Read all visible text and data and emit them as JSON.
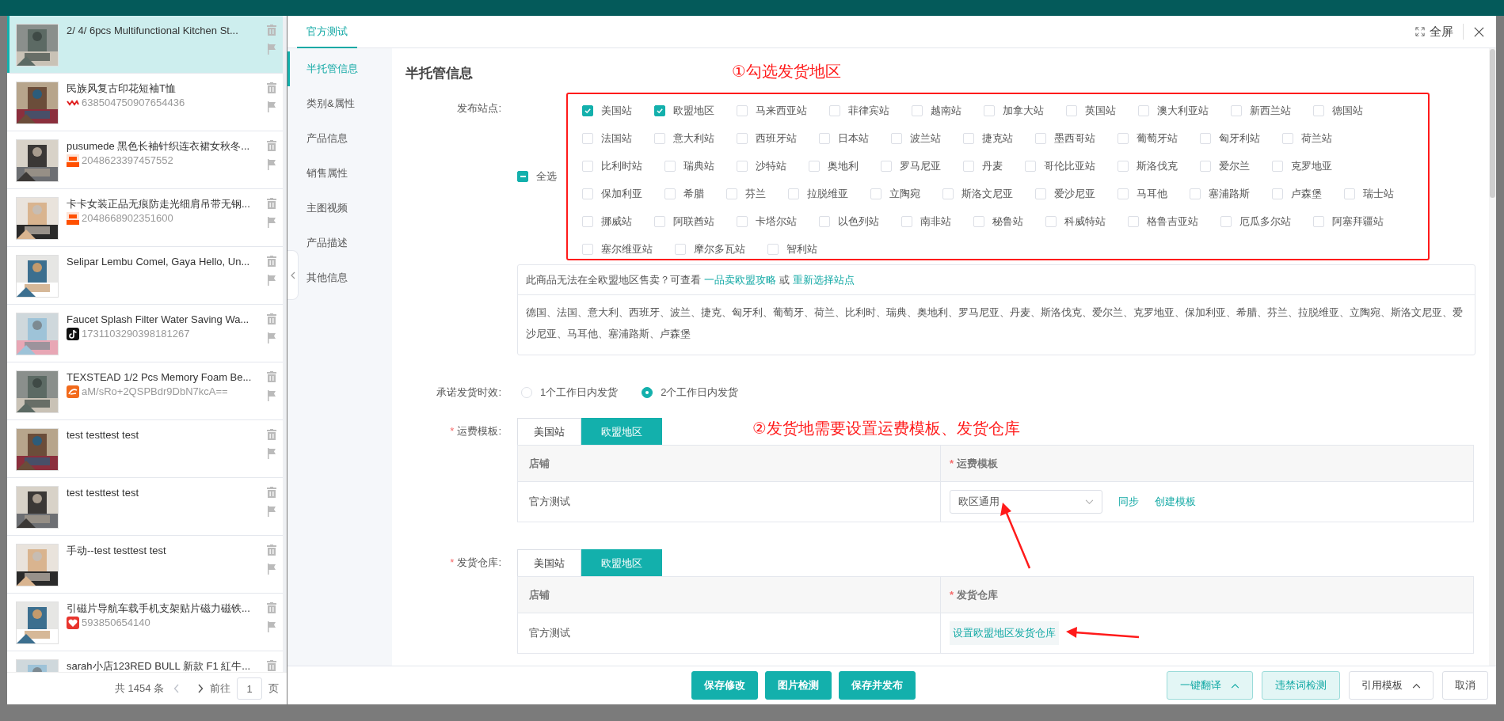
{
  "product_list": {
    "items": [
      {
        "title": "2/ 4/ 6pcs Multifunctional Kitchen St...",
        "selected": true
      },
      {
        "title": "民族风复古印花短袖T恤",
        "source": {
          "id": "638504750907654436",
          "kind": "yms"
        },
        "selected": false
      },
      {
        "title": "pusumede 黑色长袖针织连衣裙女秋冬...",
        "source": {
          "id": "2048623397457552",
          "kind": "taobao"
        },
        "selected": false
      },
      {
        "title": "卡卡女装正品无痕防走光细肩吊带无钢...",
        "source": {
          "id": "2048668902351600",
          "kind": "taobao"
        },
        "selected": false
      },
      {
        "title": "Selipar Lembu Comel, Gaya Hello, Un...",
        "selected": false
      },
      {
        "title": "Faucet Splash Filter Water Saving Wa...",
        "source": {
          "id": "1731103290398181267",
          "kind": "tiktok"
        },
        "selected": false
      },
      {
        "title": "TEXSTEAD 1/2 Pcs Memory Foam Be...",
        "source": {
          "id": "aM/sRo+2QSPBdr9DbN7kcA==",
          "kind": "alibaba"
        },
        "selected": false
      },
      {
        "title": "test testtest test",
        "selected": false
      },
      {
        "title": "test testtest test",
        "selected": false
      },
      {
        "title": "手动--test testtest test",
        "selected": false
      },
      {
        "title": "引磁片导航车载手机支架贴片磁力磁铁...",
        "source": {
          "id": "593850654140",
          "kind": "heart"
        },
        "selected": false
      },
      {
        "title": "sarah小店123RED BULL 新款 F1 紅牛...",
        "selected": false
      }
    ],
    "pagination": {
      "total": "共 1454 条",
      "goto": "前往",
      "page": "1",
      "suffix": "页"
    }
  },
  "dialog": {
    "tabs": [
      {
        "label": "官方测试",
        "selected": true
      }
    ],
    "fullscreen": "全屏",
    "nav": [
      {
        "label": "半托管信息",
        "selected": true
      },
      {
        "label": "类别&属性",
        "selected": false
      },
      {
        "label": "产品信息",
        "selected": false
      },
      {
        "label": "销售属性",
        "selected": false
      },
      {
        "label": "主图视频",
        "selected": false
      },
      {
        "label": "产品描述",
        "selected": false
      },
      {
        "label": "其他信息",
        "selected": false
      }
    ],
    "section_title": "半托管信息",
    "sites": {
      "label": "发布站点:",
      "select_all": {
        "label": "全选",
        "indeterminate": true
      },
      "options": [
        {
          "label": "美国站",
          "checked": true
        },
        {
          "label": "欧盟地区",
          "checked": true
        },
        {
          "label": "马来西亚站",
          "checked": false
        },
        {
          "label": "菲律宾站",
          "checked": false
        },
        {
          "label": "越南站",
          "checked": false
        },
        {
          "label": "加拿大站",
          "checked": false
        },
        {
          "label": "英国站",
          "checked": false
        },
        {
          "label": "澳大利亚站",
          "checked": false
        },
        {
          "label": "新西兰站",
          "checked": false
        },
        {
          "label": "德国站",
          "checked": false
        },
        {
          "label": "法国站",
          "checked": false
        },
        {
          "label": "意大利站",
          "checked": false
        },
        {
          "label": "西班牙站",
          "checked": false
        },
        {
          "label": "日本站",
          "checked": false
        },
        {
          "label": "波兰站",
          "checked": false
        },
        {
          "label": "捷克站",
          "checked": false
        },
        {
          "label": "墨西哥站",
          "checked": false
        },
        {
          "label": "葡萄牙站",
          "checked": false
        },
        {
          "label": "匈牙利站",
          "checked": false
        },
        {
          "label": "荷兰站",
          "checked": false
        },
        {
          "label": "比利时站",
          "checked": false
        },
        {
          "label": "瑞典站",
          "checked": false
        },
        {
          "label": "沙特站",
          "checked": false
        },
        {
          "label": "奥地利",
          "checked": false
        },
        {
          "label": "罗马尼亚",
          "checked": false
        },
        {
          "label": "丹麦",
          "checked": false
        },
        {
          "label": "哥伦比亚站",
          "checked": false
        },
        {
          "label": "斯洛伐克",
          "checked": false
        },
        {
          "label": "爱尔兰",
          "checked": false
        },
        {
          "label": "克罗地亚",
          "checked": false
        },
        {
          "label": "保加利亚",
          "checked": false
        },
        {
          "label": "希腊",
          "checked": false
        },
        {
          "label": "芬兰",
          "checked": false
        },
        {
          "label": "拉脱维亚",
          "checked": false
        },
        {
          "label": "立陶宛",
          "checked": false
        },
        {
          "label": "斯洛文尼亚",
          "checked": false
        },
        {
          "label": "爱沙尼亚",
          "checked": false
        },
        {
          "label": "马耳他",
          "checked": false
        },
        {
          "label": "塞浦路斯",
          "checked": false
        },
        {
          "label": "卢森堡",
          "checked": false
        },
        {
          "label": "瑞士站",
          "checked": false
        },
        {
          "label": "挪威站",
          "checked": false
        },
        {
          "label": "阿联酋站",
          "checked": false
        },
        {
          "label": "卡塔尔站",
          "checked": false
        },
        {
          "label": "以色列站",
          "checked": false
        },
        {
          "label": "南非站",
          "checked": false
        },
        {
          "label": "秘鲁站",
          "checked": false
        },
        {
          "label": "科威特站",
          "checked": false
        },
        {
          "label": "格鲁吉亚站",
          "checked": false
        },
        {
          "label": "厄瓜多尔站",
          "checked": false
        },
        {
          "label": "阿塞拜疆站",
          "checked": false
        },
        {
          "label": "塞尔维亚站",
          "checked": false
        },
        {
          "label": "摩尔多瓦站",
          "checked": false
        },
        {
          "label": "智利站",
          "checked": false
        }
      ]
    },
    "eu_notice": {
      "text": "此商品无法在全欧盟地区售卖？可查看",
      "link_1": "一品卖欧盟攻略",
      "or": "或",
      "link_2": "重新选择站点",
      "countries": "德国、法国、意大利、西班牙、波兰、捷克、匈牙利、葡萄牙、荷兰、比利时、瑞典、奥地利、罗马尼亚、丹麦、斯洛伐克、爱尔兰、克罗地亚、保加利亚、希腊、芬兰、拉脱维亚、立陶宛、斯洛文尼亚、爱沙尼亚、马耳他、塞浦路斯、卢森堡"
    },
    "ship_time": {
      "label": "承诺发货时效:",
      "options": [
        {
          "label": "1个工作日内发货",
          "selected": false
        },
        {
          "label": "2个工作日内发货",
          "selected": true
        }
      ]
    },
    "freight": {
      "label": "运费模板:",
      "required_mark": "*",
      "tabs": [
        {
          "label": "美国站",
          "selected": false
        },
        {
          "label": "欧盟地区",
          "selected": true
        }
      ],
      "columns": [
        {
          "label": "店铺"
        },
        {
          "label": "运费模板",
          "required_mark": "*"
        }
      ],
      "row": {
        "shop": "官方测试",
        "value": "欧区通用",
        "actions": [
          "同步",
          "创建模板"
        ]
      }
    },
    "warehouse": {
      "label": "发货仓库:",
      "required_mark": "*",
      "tabs": [
        {
          "label": "美国站",
          "selected": false
        },
        {
          "label": "欧盟地区",
          "selected": true
        }
      ],
      "columns": [
        {
          "label": "店铺"
        },
        {
          "label": "发货仓库",
          "required_mark": "*"
        }
      ],
      "row": {
        "shop": "官方测试",
        "link": "设置欧盟地区发货仓库"
      }
    },
    "footer": {
      "center_buttons": [
        {
          "label": "保存修改",
          "kind": "primary",
          "menu": false
        },
        {
          "label": "图片检测",
          "kind": "primary",
          "menu": false
        },
        {
          "label": "保存并发布",
          "kind": "primary",
          "menu": false
        }
      ],
      "right_buttons": [
        {
          "label": "一键翻译",
          "kind": "tinted",
          "menu": true
        },
        {
          "label": "违禁词检测",
          "kind": "tinted",
          "menu": false
        },
        {
          "label": "引用模板",
          "kind": "default",
          "menu": true
        },
        {
          "label": "取消",
          "kind": "default",
          "menu": false
        }
      ]
    }
  },
  "annotations": [
    {
      "text": "①勾选发货地区"
    },
    {
      "text": "②发货地需要设置运费模板、发货仓库"
    }
  ]
}
